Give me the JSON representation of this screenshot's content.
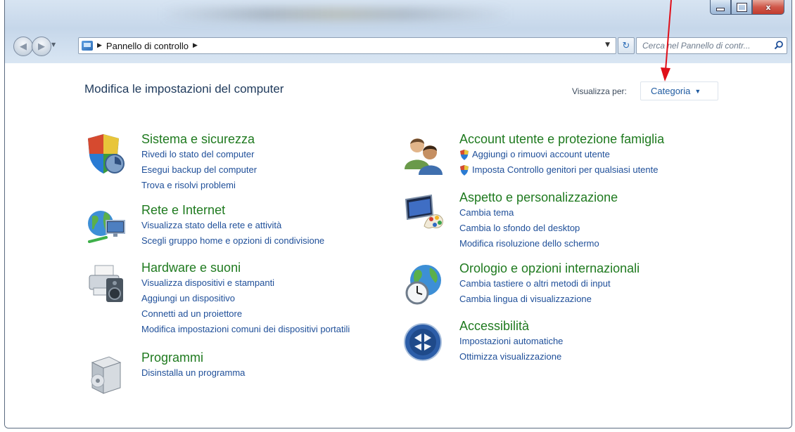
{
  "window": {
    "caption": {
      "minimize": "–",
      "maximize": "□",
      "close": "x"
    }
  },
  "nav": {
    "breadcrumb": [
      "Pannello di controllo"
    ],
    "search_placeholder": "Cerca nel Pannello di contr..."
  },
  "header": {
    "title": "Modifica le impostazioni del computer",
    "view_by_label": "Visualizza per:",
    "view_by_value": "Categoria"
  },
  "categories": [
    {
      "title": "Sistema e sicurezza",
      "icon": "shield-icon",
      "links": [
        "Rivedi lo stato del computer",
        "Esegui backup del computer",
        "Trova e risolvi problemi"
      ]
    },
    {
      "title": "Rete e Internet",
      "icon": "network-globe-icon",
      "links": [
        "Visualizza stato della rete e attività",
        "Scegli gruppo home e opzioni di condivisione"
      ]
    },
    {
      "title": "Hardware e suoni",
      "icon": "printer-speaker-icon",
      "links": [
        "Visualizza dispositivi e stampanti",
        "Aggiungi un dispositivo",
        "Connetti ad un proiettore",
        "Modifica impostazioni comuni dei dispositivi portatili"
      ]
    },
    {
      "title": "Programmi",
      "icon": "programs-box-icon",
      "links": [
        "Disinstalla un programma"
      ]
    },
    {
      "title": "Account utente e protezione famiglia",
      "icon": "users-icon",
      "links": [
        "Aggiungi o rimuovi account utente",
        "Imposta Controllo genitori per qualsiasi utente"
      ],
      "links_have_shield": true
    },
    {
      "title": "Aspetto e personalizzazione",
      "icon": "monitor-palette-icon",
      "links": [
        "Cambia tema",
        "Cambia lo sfondo del desktop",
        "Modifica risoluzione dello schermo"
      ]
    },
    {
      "title": "Orologio e opzioni internazionali",
      "icon": "globe-clock-icon",
      "links": [
        "Cambia tastiere o altri metodi di input",
        "Cambia lingua di visualizzazione"
      ]
    },
    {
      "title": "Accessibilità",
      "icon": "accessibility-icon",
      "links": [
        "Impostazioni automatiche",
        "Ottimizza visualizzazione"
      ]
    }
  ],
  "colors": {
    "category_title": "#1f7a1f",
    "link": "#1f4f99",
    "annotation_arrow": "#e0101a"
  }
}
